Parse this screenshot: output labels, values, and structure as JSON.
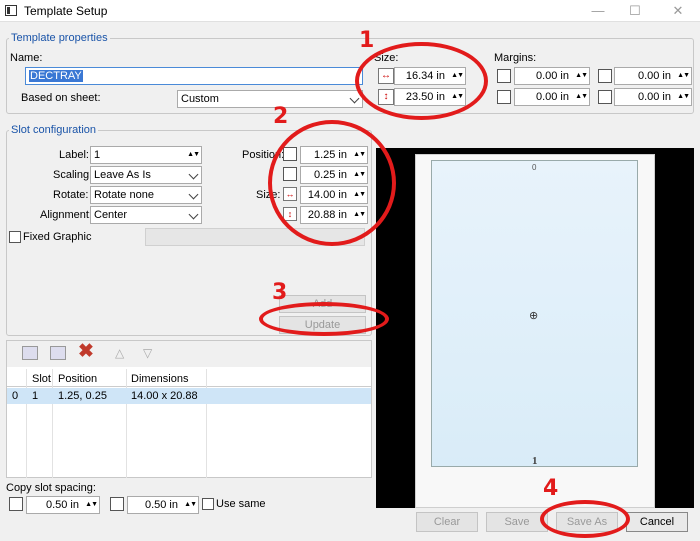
{
  "window": {
    "title": "Template Setup"
  },
  "template_properties": {
    "legend": "Template properties",
    "name_label": "Name:",
    "name_value": "DECTRAY",
    "based_on_label": "Based on sheet:",
    "based_on_value": "Custom",
    "size_label": "Size:",
    "width": "16.34 in",
    "height": "23.50 in",
    "margins_label": "Margins:",
    "margin_left": "0.00 in",
    "margin_top": "0.00 in",
    "margin_right": "0.00 in",
    "margin_bottom": "0.00 in"
  },
  "slot_config": {
    "legend": "Slot configuration",
    "label_label": "Label:",
    "label_value": "1",
    "scaling_label": "Scaling:",
    "scaling_value": "Leave As Is",
    "rotate_label": "Rotate:",
    "rotate_value": "Rotate none",
    "alignment_label": "Alignment:",
    "alignment_value": "Center",
    "position_label": "Position:",
    "pos_x": "1.25 in",
    "pos_y": "0.25 in",
    "size_label": "Size:",
    "size_w": "14.00 in",
    "size_h": "20.88 in",
    "fixed_graphic_label": "Fixed Graphic",
    "add_label": "Add",
    "update_label": "Update"
  },
  "slot_table": {
    "columns": [
      "",
      "Slot",
      "Position",
      "Dimensions"
    ],
    "rows": [
      {
        "index": "0",
        "slot": "1",
        "position": "1.25, 0.25",
        "dimensions": "14.00 x 20.88"
      }
    ]
  },
  "copy_spacing": {
    "label": "Copy slot spacing:",
    "horizontal": "0.50 in",
    "vertical": "0.50 in",
    "use_same_label": "Use same"
  },
  "preview": {
    "top_label": "0",
    "bottom_label": "1"
  },
  "buttons": {
    "clear": "Clear",
    "save": "Save",
    "save_as": "Save As",
    "cancel": "Cancel"
  },
  "annotations": {
    "n1": "1",
    "n2": "2",
    "n3": "3",
    "n4": "4"
  },
  "colors": {
    "annotation": "#e21b1b",
    "legend": "#1a54a8",
    "preview_bg": "#000000",
    "selection": "#cfe5f7"
  },
  "icons": [
    "app-icon",
    "copy-slot-icon",
    "paste-slot-icon",
    "delete-icon",
    "move-up-icon",
    "move-down-icon",
    "crosshair-icon"
  ]
}
